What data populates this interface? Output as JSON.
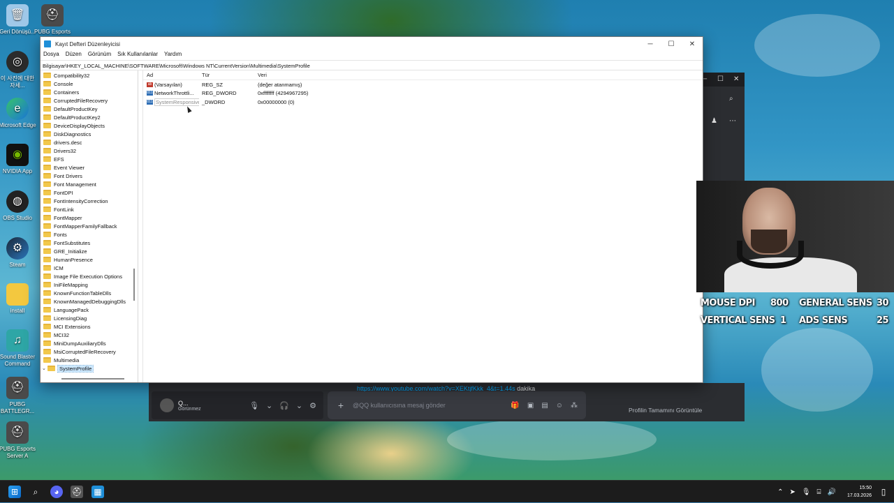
{
  "desktop": {
    "icons": [
      {
        "label": "Geri Dönüşü...",
        "icon": "recycle-bin-icon"
      },
      {
        "label": "PUBG Esports",
        "icon": "pubg-icon"
      },
      {
        "label": "이 사진에 대한 자세...",
        "icon": "photo-info-icon"
      },
      {
        "label": "Microsoft Edge",
        "icon": "edge-icon"
      },
      {
        "label": "NVIDIA App",
        "icon": "nvidia-icon"
      },
      {
        "label": "OBS Studio",
        "icon": "obs-icon"
      },
      {
        "label": "Steam",
        "icon": "steam-icon"
      },
      {
        "label": "install",
        "icon": "folder-icon"
      },
      {
        "label": "Sound Blaster Command",
        "icon": "sound-blaster-icon"
      },
      {
        "label": "PUBG BATTLEGR...",
        "icon": "pubg-icon"
      },
      {
        "label": "PUBG Esports Server A",
        "icon": "pubg-icon"
      }
    ]
  },
  "regedit": {
    "title": "Kayıt Defteri Düzenleyicisi",
    "menu": [
      "Dosya",
      "Düzen",
      "Görünüm",
      "Sık Kullanılanlar",
      "Yardım"
    ],
    "address": "Bilgisayar\\HKEY_LOCAL_MACHINE\\SOFTWARE\\Microsoft\\Windows NT\\CurrentVersion\\Multimedia\\SystemProfile",
    "tree": [
      "Compatibility32",
      "Console",
      "Containers",
      "CorruptedFileRecovery",
      "DefaultProductKey",
      "DefaultProductKey2",
      "DeviceDisplayObjects",
      "DiskDiagnostics",
      "drivers.desc",
      "Drivers32",
      "EFS",
      "Event Viewer",
      "Font Drivers",
      "Font Management",
      "FontDPI",
      "FontIntensityCorrection",
      "FontLink",
      "FontMapper",
      "FontMapperFamilyFallback",
      "Fonts",
      "FontSubstitutes",
      "GRE_Initialize",
      "HumanPresence",
      "ICM",
      "Image File Execution Options",
      "IniFileMapping",
      "KnownFunctionTableDlls",
      "KnownManagedDebuggingDlls",
      "LanguagePack",
      "LicensingDiag",
      "MCI Extensions",
      "MCI32",
      "MiniDumpAuxiliaryDlls",
      "MsiCorruptedFileRecovery",
      "Multimedia"
    ],
    "selected_child": "SystemProfile",
    "columns": {
      "name": "Ad",
      "type": "Tür",
      "data": "Veri"
    },
    "values": [
      {
        "name": "(Varsayılan)",
        "type": "REG_SZ",
        "data": "(değer atanmamış)",
        "kind": "sz"
      },
      {
        "name": "NetworkThrottli...",
        "type": "REG_DWORD",
        "data": "0xffffffff (4294967295)",
        "kind": "dw"
      },
      {
        "name": "SystemResponsiveness",
        "type": "_DWORD",
        "data": "0x00000000 (0)",
        "kind": "dw"
      }
    ]
  },
  "discord": {
    "link_text": "https://www.youtube.com/watch?v=XEKtjfKkk_4&t=1.44s",
    "link_suffix": "dakika",
    "user": {
      "name": "Q...",
      "status": "Görünmez"
    },
    "message_placeholder": "@QQ kullanıcısına mesaj gönder",
    "profile_link": "Profilin Tamamını Görüntüle"
  },
  "overlay": {
    "mouse_dpi_label": "MOUSE DPI",
    "mouse_dpi_value": "800",
    "general_sens_label": "GENERAL SENS",
    "general_sens_value": "30",
    "vertical_sens_label": "VERTICAL SENS",
    "vertical_sens_value": "1",
    "ads_sens_label": "ADS SENS",
    "ads_sens_value": "25"
  },
  "taskbar": {
    "time": "15:50",
    "date": "17.03.2026"
  }
}
